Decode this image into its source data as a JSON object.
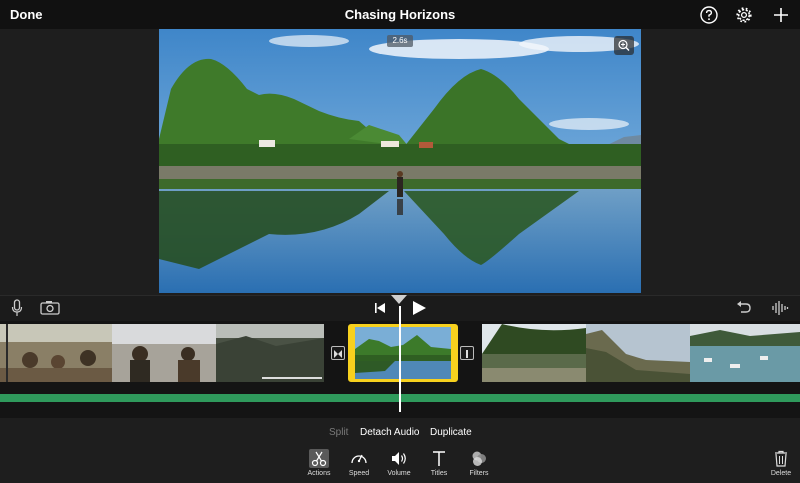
{
  "header": {
    "done_label": "Done",
    "title": "Chasing Horizons",
    "help_icon": "question-circle-icon",
    "settings_icon": "gear-icon",
    "add_icon": "plus-icon"
  },
  "viewer": {
    "duration_badge": "2.6s",
    "zoom_icon": "magnifier-icon"
  },
  "transport": {
    "mic_icon": "microphone-icon",
    "camera_icon": "camera-icon",
    "skip_start_icon": "skip-to-start-icon",
    "play_icon": "play-icon",
    "undo_icon": "undo-icon",
    "audio_icon": "waveform-icon"
  },
  "actions": {
    "split": "Split",
    "detach_audio": "Detach Audio",
    "duplicate": "Duplicate"
  },
  "toolbar": {
    "items": [
      {
        "label": "Actions",
        "icon": "scissors-icon"
      },
      {
        "label": "Speed",
        "icon": "speedometer-icon"
      },
      {
        "label": "Volume",
        "icon": "speaker-icon"
      },
      {
        "label": "Titles",
        "icon": "text-t-icon"
      },
      {
        "label": "Filters",
        "icon": "filters-circles-icon"
      }
    ],
    "delete_label": "Delete",
    "delete_icon": "trash-icon"
  },
  "colors": {
    "selection": "#f7d11e",
    "audio_track": "#2f9a5c"
  }
}
